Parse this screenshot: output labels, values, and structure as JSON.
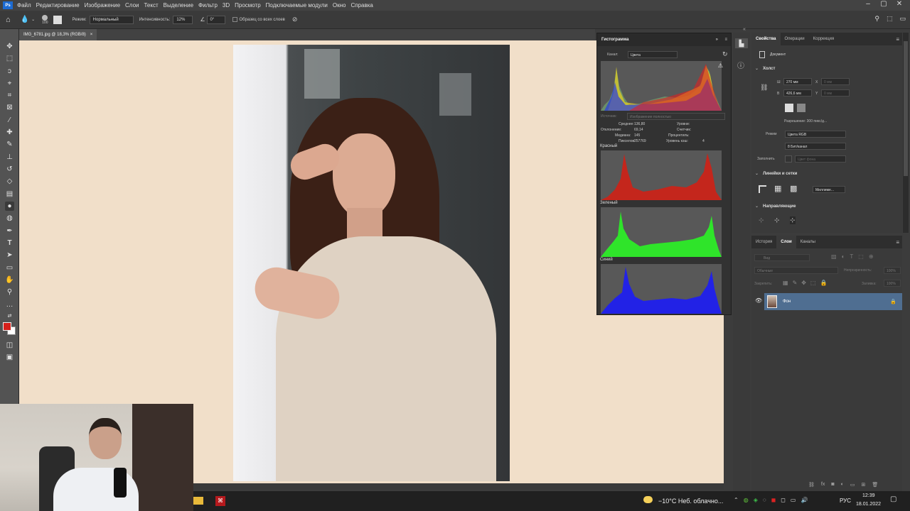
{
  "app": {
    "logo": "Ps"
  },
  "menu": [
    "Файл",
    "Редактирование",
    "Изображение",
    "Слои",
    "Текст",
    "Выделение",
    "Фильтр",
    "3D",
    "Просмотр",
    "Подключаемые модули",
    "Окно",
    "Справка"
  ],
  "options": {
    "brush_size": "100",
    "mode_label": "Режим:",
    "mode_value": "Нормальный",
    "intensity_label": "Интенсивность:",
    "intensity_value": "12%",
    "angle_value": "0°",
    "sample_all_label": "Образец со всех слоев"
  },
  "document": {
    "tab_title": "IMG_6781.jpg @ 18,3% (RGB/8)",
    "tab_close": "×"
  },
  "histogram": {
    "title": "Гистограмма",
    "channel_label": "Канал:",
    "channel_value": "Цвета",
    "source_label": "Источник:",
    "source_value": "Изображение полностью",
    "stats": {
      "mean_label": "Среднее:",
      "mean": "136,80",
      "stddev_label": "Отклонение:",
      "stddev": "69,14",
      "median_label": "Медиана:",
      "median": "145",
      "pixels_label": "Пикселов:",
      "pixels": "257769",
      "levels_label": "Уровни:",
      "count_label": "Счетчик:",
      "percentile_label": "Процентиль:",
      "cache_label": "Уровень кэш:",
      "cache": "4"
    },
    "red_label": "Красный",
    "green_label": "Зеленый",
    "blue_label": "Синий",
    "colors": {
      "red": "#c4261c",
      "green": "#2fe42a",
      "blue": "#2222e6"
    }
  },
  "properties": {
    "tabs": [
      "Свойства",
      "Операции",
      "Коррекция"
    ],
    "doc_label": "Документ",
    "canvas_section": "Холст",
    "w_label": "Ш",
    "w_value": "270 мм",
    "h_label": "В",
    "h_value": "426,6 мм",
    "x_label": "X",
    "x_value": "0 мм",
    "y_label": "Y",
    "y_value": "0 мм",
    "resolution": "Разрешение: 300 пикс/д...",
    "mode_label": "Режим",
    "mode_value": "Цвета RGB",
    "depth_value": "8 Бит/канал",
    "fill_label": "Заполнить",
    "fill_value": "Цвет фона",
    "rulers_section": "Линейки и сетки",
    "units_value": "Миллиме...",
    "guides_section": "Направляющие"
  },
  "layers_panel": {
    "tabs": [
      "История",
      "Слои",
      "Каналы"
    ],
    "search_placeholder": "Вид",
    "blend_mode": "Обычные",
    "opacity_label": "Непрозрачность:",
    "opacity_value": "100%",
    "lock_label": "Закрепить:",
    "fill_label": "Заливка:",
    "fill_value": "100%",
    "layer_name": "Фон"
  },
  "taskbar": {
    "weather": "−10°C Неб. облачно...",
    "lang": "РУС",
    "time": "12:39",
    "date": "18.01.2022"
  }
}
